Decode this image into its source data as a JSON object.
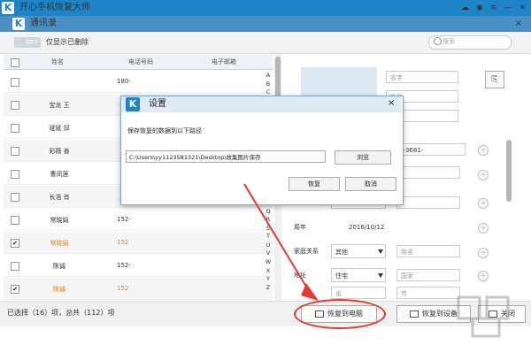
{
  "app": {
    "title": "开心手机恢复大师",
    "logo_letter": "K",
    "brand_color": "#1d84c8"
  },
  "titlebar_icons": [
    "wechat-icon",
    "chat-icon",
    "menu-icon",
    "minimize-icon",
    "close-icon"
  ],
  "window": {
    "title": "通讯录",
    "logo_letter": "K",
    "close_glyph": "×"
  },
  "toolbar": {
    "toggle_label": "OFF",
    "show_deleted_label": "仅显示已删除",
    "search_placeholder": "搜索"
  },
  "table": {
    "headers": {
      "name": "姓名",
      "phone": "电话号码",
      "email": "电子邮箱"
    },
    "rows": [
      {
        "checked": false,
        "name": "",
        "phone": "180-",
        "highlight": false
      },
      {
        "checked": false,
        "name": "宝龙 王",
        "phone": "",
        "highlight": false
      },
      {
        "checked": false,
        "name": "斌斌 邱",
        "phone": "",
        "highlight": false
      },
      {
        "checked": false,
        "name": "彩薇 善",
        "phone": "",
        "highlight": false
      },
      {
        "checked": false,
        "name": "曹凤莲",
        "phone": "",
        "highlight": false
      },
      {
        "checked": false,
        "name": "长浩 肖",
        "phone": "",
        "highlight": false
      },
      {
        "checked": false,
        "name": "常晓娟",
        "phone": "152-",
        "highlight": false
      },
      {
        "checked": true,
        "name": "常晓娟",
        "phone": "152",
        "highlight": true
      },
      {
        "checked": false,
        "name": "陈诚",
        "phone": "152-",
        "highlight": false
      },
      {
        "checked": true,
        "name": "陈诚",
        "phone": "152",
        "highlight": true
      }
    ],
    "alphabet": [
      "A",
      "B",
      "C",
      "D",
      "E",
      "F",
      "G",
      "H",
      "I",
      "J",
      "K",
      "L",
      "M",
      "N",
      "O",
      "P",
      "Q",
      "R",
      "S",
      "T",
      "U",
      "V",
      "W",
      "X",
      "Y",
      "Z"
    ]
  },
  "detail": {
    "name_placeholder": "名字",
    "surname_placeholder": "姓名",
    "phone_value": "0-3681-",
    "type_selected": "住宅",
    "anniversary_label": "周年",
    "anniversary_value": "2016/10/12",
    "relation_label": "家庭关系",
    "relation_selected": "其他",
    "relation_placeholder": "姓名",
    "address_label": "地址",
    "address_selected": "住宅",
    "country_placeholder": "国家",
    "province_placeholder": "省",
    "city_placeholder": "市",
    "label_partial": "on"
  },
  "dialog": {
    "logo_letter": "K",
    "title": "设置",
    "close_glyph": "×",
    "label": "保存恢复的数据到以下路径",
    "path": "C:\\Users\\yy1123581321\\Desktop\\收集图片保存",
    "browse_label": "浏览",
    "restore_label": "恢复",
    "cancel_label": "取消"
  },
  "footer": {
    "status": "已选择（16）项，总共（112）项",
    "restore_pc_label": "恢复到电脑",
    "restore_device_label": "恢复到设备",
    "close_label": "关闭"
  },
  "annotation_color": "#e53a30"
}
